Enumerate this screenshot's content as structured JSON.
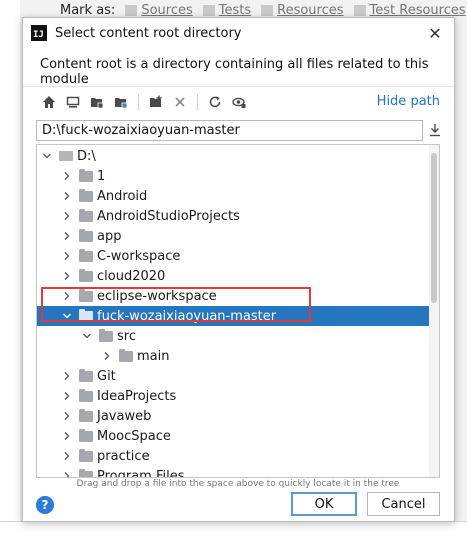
{
  "background": {
    "mark_as_label": "Mark as:",
    "marks": [
      "Sources",
      "Tests",
      "Resources",
      "Test Resources"
    ]
  },
  "dialog": {
    "title": "Select content root directory",
    "close": "✕",
    "description": "Content root is a directory containing all files related to this module",
    "hide_path": "Hide path",
    "path_value": "D:\\fuck-wozaixiaoyuan-master",
    "hint": "Drag and drop a file into the space above to quickly locate it in the tree",
    "ok": "OK",
    "cancel": "Cancel",
    "help": "?"
  },
  "tree": [
    {
      "label": "D:\\",
      "level": 0,
      "expanded": true,
      "type": "drive"
    },
    {
      "label": "1",
      "level": 1,
      "expanded": false
    },
    {
      "label": "Android",
      "level": 1,
      "expanded": false
    },
    {
      "label": "AndroidStudioProjects",
      "level": 1,
      "expanded": false
    },
    {
      "label": "app",
      "level": 1,
      "expanded": false
    },
    {
      "label": "C-workspace",
      "level": 1,
      "expanded": false
    },
    {
      "label": "cloud2020",
      "level": 1,
      "expanded": false
    },
    {
      "label": "eclipse-workspace",
      "level": 1,
      "expanded": false
    },
    {
      "label": "fuck-wozaixiaoyuan-master",
      "level": 1,
      "expanded": true,
      "selected": true
    },
    {
      "label": "src",
      "level": 2,
      "expanded": true
    },
    {
      "label": "main",
      "level": 3,
      "expanded": false
    },
    {
      "label": "Git",
      "level": 1,
      "expanded": false
    },
    {
      "label": "IdeaProjects",
      "level": 1,
      "expanded": false
    },
    {
      "label": "Javaweb",
      "level": 1,
      "expanded": false
    },
    {
      "label": "MoocSpace",
      "level": 1,
      "expanded": false
    },
    {
      "label": "practice",
      "level": 1,
      "expanded": false
    },
    {
      "label": "Program Files",
      "level": 1,
      "expanded": false
    }
  ],
  "colors": {
    "selection": "#2675bf",
    "link": "#2470c9",
    "highlight_box": "#e23a3a"
  }
}
